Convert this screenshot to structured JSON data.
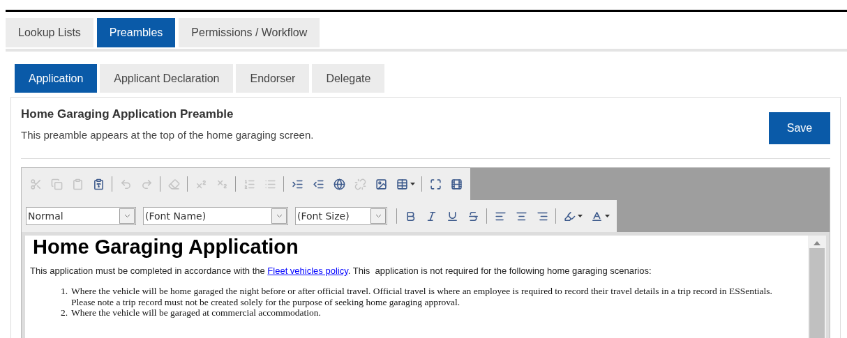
{
  "main_tabs": [
    {
      "label": "Lookup Lists",
      "selected": false
    },
    {
      "label": "Preambles",
      "selected": true
    },
    {
      "label": "Permissions / Workflow",
      "selected": false
    }
  ],
  "sub_tabs": [
    {
      "label": "Application",
      "selected": true
    },
    {
      "label": "Applicant Declaration",
      "selected": false
    },
    {
      "label": "Endorser",
      "selected": false
    },
    {
      "label": "Delegate",
      "selected": false
    }
  ],
  "section": {
    "title": "Home Garaging Application Preamble",
    "description": "This preamble appears at the top of the home garaging screen.",
    "save_button": "Save"
  },
  "editor": {
    "toolbar_row_1": [
      {
        "kind": "cut",
        "disabled": true
      },
      {
        "kind": "copy",
        "disabled": true
      },
      {
        "kind": "paste",
        "disabled": true
      },
      {
        "kind": "paste-word",
        "disabled": false
      },
      {
        "kind": "separator"
      },
      {
        "kind": "undo",
        "disabled": true
      },
      {
        "kind": "redo",
        "disabled": true
      },
      {
        "kind": "separator"
      },
      {
        "kind": "clear-format",
        "disabled": true
      },
      {
        "kind": "separator"
      },
      {
        "kind": "superscript",
        "disabled": true
      },
      {
        "kind": "subscript",
        "disabled": true
      },
      {
        "kind": "separator"
      },
      {
        "kind": "ordered-list",
        "disabled": true
      },
      {
        "kind": "bullet-list",
        "disabled": true
      },
      {
        "kind": "separator"
      },
      {
        "kind": "indent",
        "disabled": false
      },
      {
        "kind": "outdent",
        "disabled": false
      },
      {
        "kind": "link",
        "disabled": false
      },
      {
        "kind": "unlink",
        "disabled": true
      },
      {
        "kind": "image",
        "disabled": false
      },
      {
        "kind": "table",
        "disabled": false,
        "has_menu": true
      },
      {
        "kind": "separator"
      },
      {
        "kind": "fullscreen",
        "disabled": false
      },
      {
        "kind": "media",
        "disabled": false
      }
    ],
    "dropdowns": [
      {
        "value": "Normal"
      },
      {
        "value": "(Font Name)"
      },
      {
        "value": "(Font Size)"
      }
    ],
    "toolbar_row_2": [
      {
        "kind": "separator"
      },
      {
        "kind": "bold",
        "disabled": false
      },
      {
        "kind": "italic",
        "disabled": false
      },
      {
        "kind": "underline",
        "disabled": false
      },
      {
        "kind": "strikethrough",
        "disabled": false
      },
      {
        "kind": "separator"
      },
      {
        "kind": "align-left",
        "disabled": false
      },
      {
        "kind": "align-center",
        "disabled": false
      },
      {
        "kind": "align-right",
        "disabled": false
      },
      {
        "kind": "separator"
      },
      {
        "kind": "highlight",
        "disabled": false,
        "has_menu": true
      },
      {
        "kind": "font-color",
        "disabled": false,
        "has_menu": true
      }
    ],
    "content": {
      "heading": "Home Garaging Application",
      "paragraph": {
        "before": "This application must be completed in accordance with the ",
        "link": "Fleet vehicles policy",
        "after": ". This  application is not required for the following home garaging scenarios:"
      },
      "list": [
        {
          "marker": "1.",
          "text": "Where the vehicle will be home garaged the night before or after official travel. Official travel is where an employee is required to record their travel details in a trip record in ESSentials. Please note a trip record must not be created solely for the purpose of seeking home garaging approval."
        },
        {
          "marker": "2.",
          "text": "Where the vehicle will be garaged at commercial accommodation."
        }
      ]
    }
  }
}
